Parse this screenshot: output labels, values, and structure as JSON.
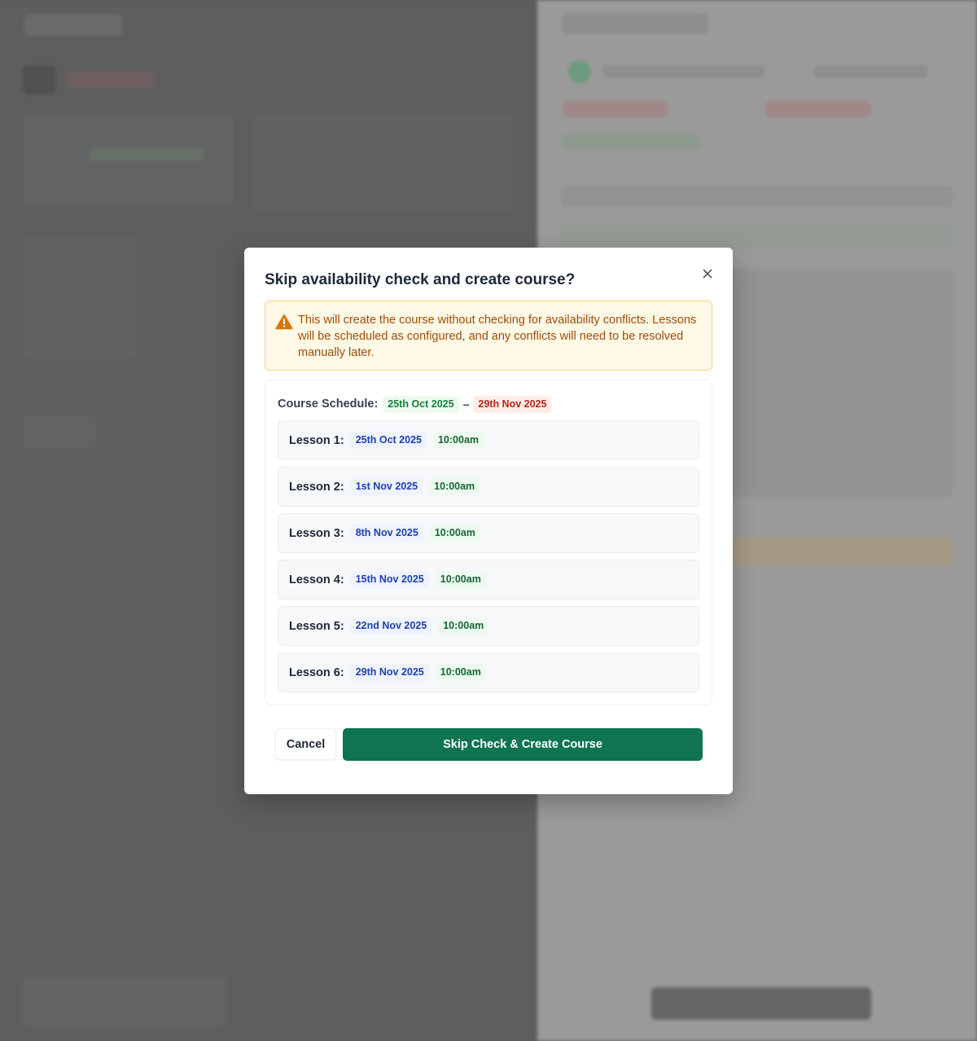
{
  "modal": {
    "title": "Skip availability check and create course?",
    "warning": "This will create the course without checking for availability conflicts. Lessons will be scheduled as configured, and any conflicts will need to be resolved manually later.",
    "schedule_label": "Course Schedule:",
    "schedule_start": "25th Oct 2025",
    "schedule_separator": "–",
    "schedule_end": "29th Nov 2025",
    "lessons": [
      {
        "label": "Lesson 1:",
        "date": "25th Oct 2025",
        "time": "10:00am"
      },
      {
        "label": "Lesson 2:",
        "date": "1st Nov 2025",
        "time": "10:00am"
      },
      {
        "label": "Lesson 3:",
        "date": "8th Nov 2025",
        "time": "10:00am"
      },
      {
        "label": "Lesson 4:",
        "date": "15th Nov 2025",
        "time": "10:00am"
      },
      {
        "label": "Lesson 5:",
        "date": "22nd Nov 2025",
        "time": "10:00am"
      },
      {
        "label": "Lesson 6:",
        "date": "29th Nov 2025",
        "time": "10:00am"
      }
    ],
    "cancel_label": "Cancel",
    "confirm_label": "Skip Check & Create Course"
  },
  "colors": {
    "primary": "#0f7450",
    "warning_bg": "#fff9e6",
    "warning_text": "#a24a07",
    "start_date": "#15803d",
    "end_date": "#b4231a",
    "lesson_date": "#1e40af"
  },
  "icons": {
    "close": "close-icon",
    "warning": "warning-triangle-icon"
  }
}
